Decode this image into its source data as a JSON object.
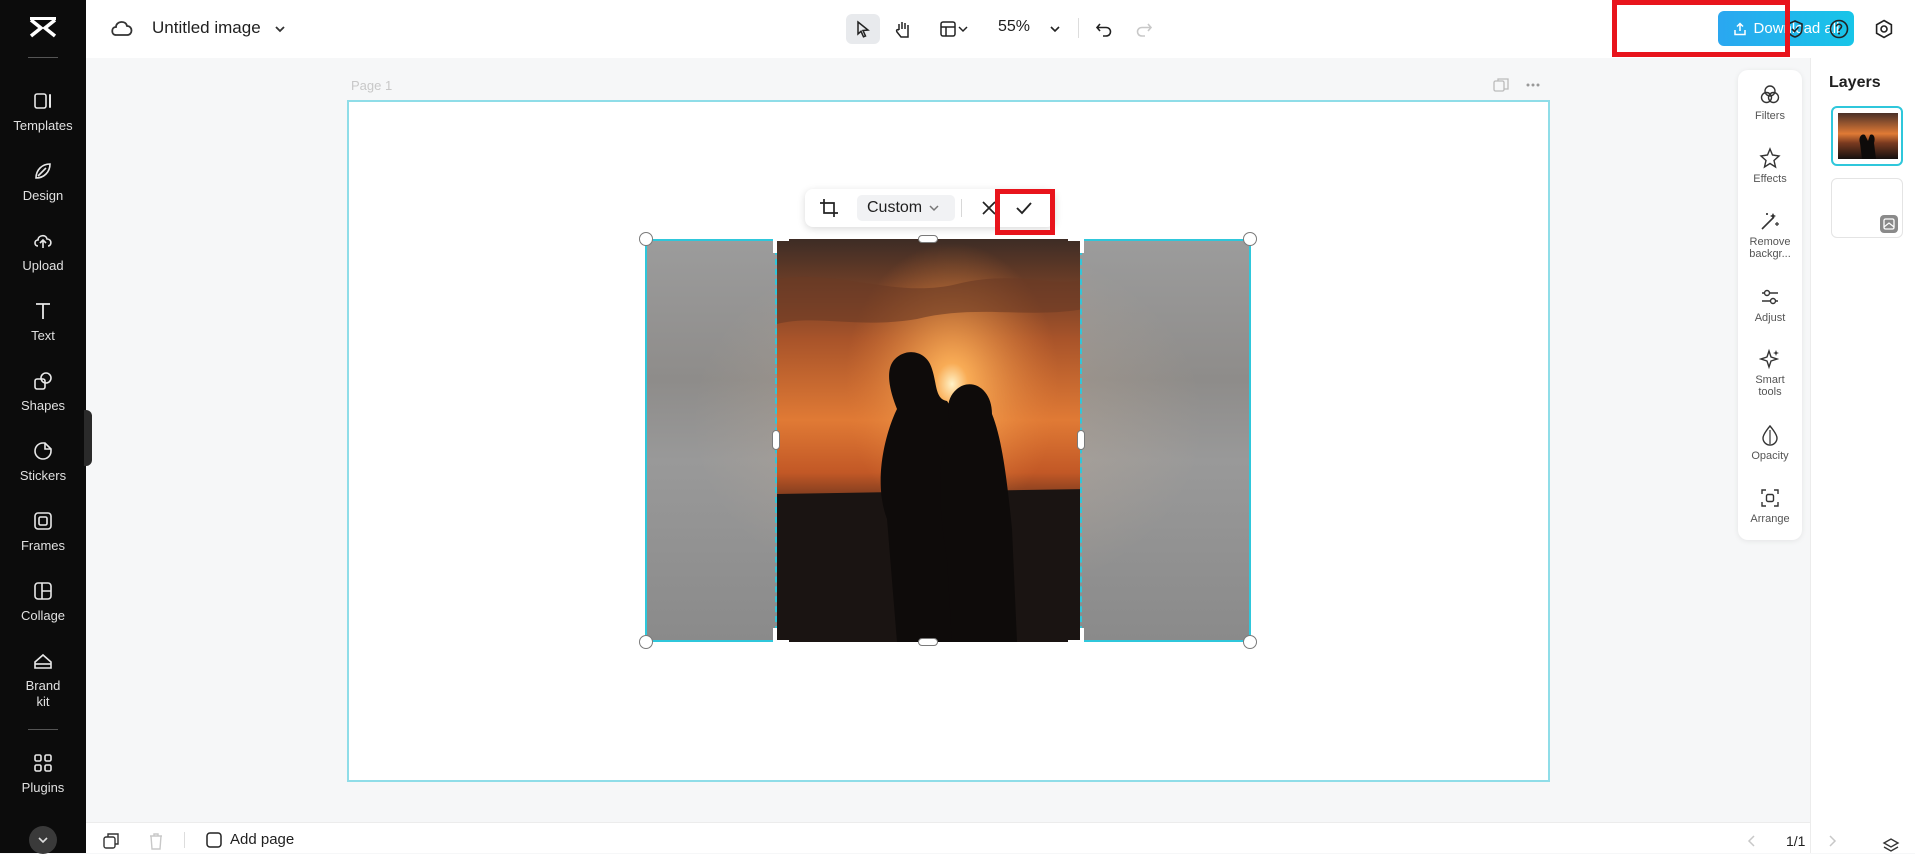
{
  "app": {
    "document_title": "Untitled image",
    "zoom": "55%",
    "download_label": "Download all"
  },
  "sidebar": {
    "items": [
      {
        "label": "Templates",
        "icon": "templates-icon"
      },
      {
        "label": "Design",
        "icon": "design-icon"
      },
      {
        "label": "Upload",
        "icon": "upload-icon"
      },
      {
        "label": "Text",
        "icon": "text-icon"
      },
      {
        "label": "Shapes",
        "icon": "shapes-icon"
      },
      {
        "label": "Stickers",
        "icon": "stickers-icon"
      },
      {
        "label": "Frames",
        "icon": "frames-icon"
      },
      {
        "label": "Collage",
        "icon": "collage-icon"
      },
      {
        "label": "Brand kit",
        "icon": "brand-kit-icon"
      },
      {
        "label": "Plugins",
        "icon": "plugins-icon"
      }
    ]
  },
  "canvas": {
    "page_label": "Page 1"
  },
  "crop_toolbar": {
    "ratio_label": "Custom"
  },
  "tools_panel": {
    "items": [
      {
        "label": "Filters",
        "icon": "filters-icon"
      },
      {
        "label": "Effects",
        "icon": "effects-icon"
      },
      {
        "label": "Remove backgr...",
        "icon": "remove-background-icon"
      },
      {
        "label": "Adjust",
        "icon": "adjust-icon"
      },
      {
        "label": "Smart tools",
        "icon": "smart-tools-icon"
      },
      {
        "label": "Opacity",
        "icon": "opacity-icon"
      },
      {
        "label": "Arrange",
        "icon": "arrange-icon"
      }
    ]
  },
  "layers": {
    "title": "Layers"
  },
  "bottom_bar": {
    "add_page_label": "Add page",
    "page_count": "1/1"
  },
  "colors": {
    "accent": "#2fc7db",
    "download_button": "#1fb5ec",
    "highlight_box": "#e8141c"
  }
}
